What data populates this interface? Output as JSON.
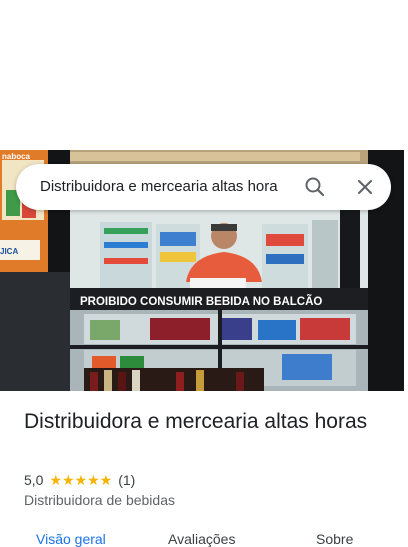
{
  "search": {
    "query": "Distribuidora e mercearia altas hora"
  },
  "photo": {
    "sign_text": "PROIBIDO CONSUMIR BEBIDA NO BALCÃO",
    "poster_text_top": "naboca",
    "poster_text_bottom": "JICA"
  },
  "place": {
    "title": "Distribuidora e mercearia altas horas",
    "rating_value": "5,0",
    "stars": "★★★★★",
    "review_count": "(1)",
    "category": "Distribuidora de bebidas"
  },
  "tabs": [
    {
      "label": "Visão geral"
    },
    {
      "label": "Avaliações"
    },
    {
      "label": "Sobre"
    }
  ],
  "colors": {
    "accent": "#1a73e8",
    "star": "#f6b400",
    "text_primary": "#202124",
    "text_secondary": "#5f6368"
  }
}
